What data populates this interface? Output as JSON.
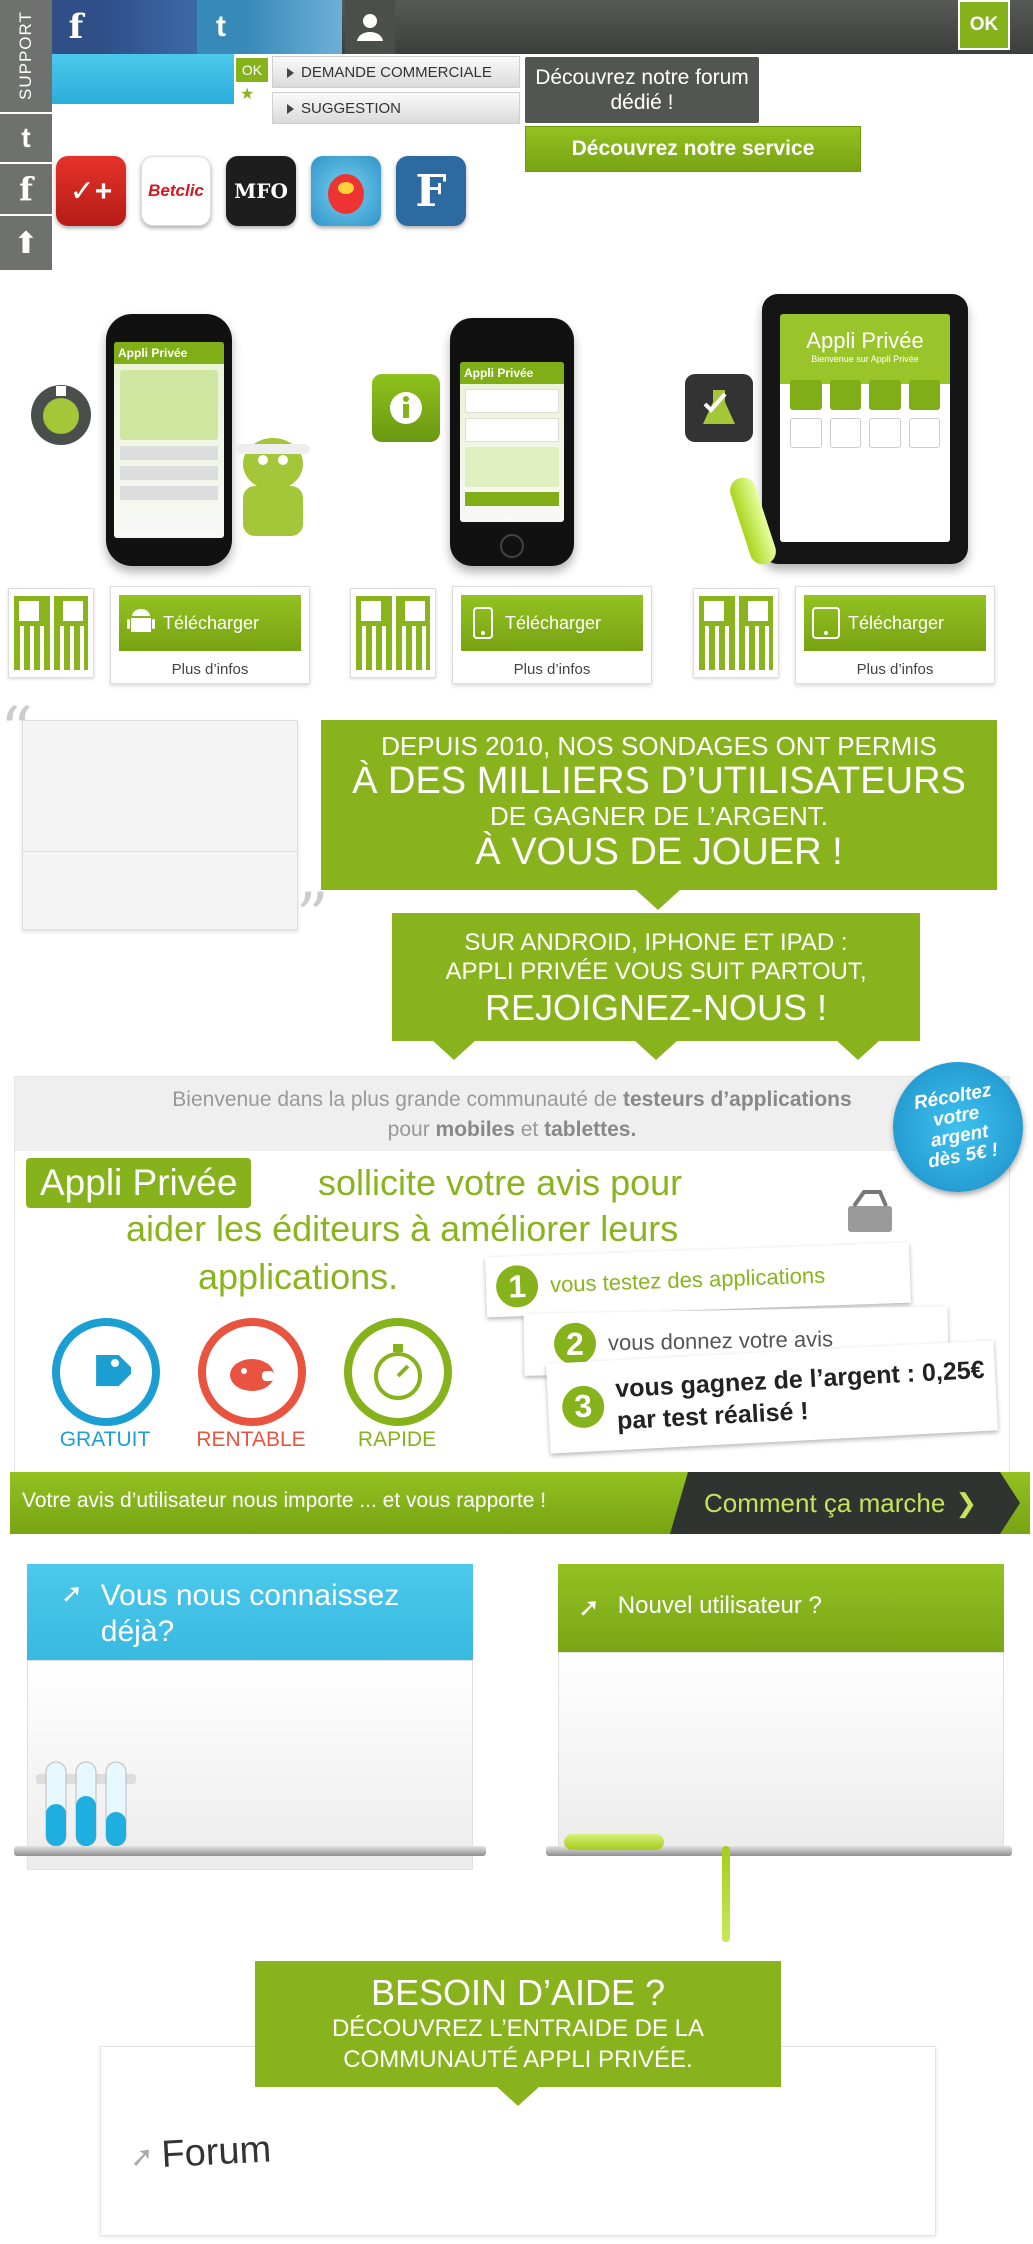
{
  "topbar": {
    "ok_label": "OK"
  },
  "side": {
    "support_label": "SUPPORT"
  },
  "contact": {
    "ok_label": "OK",
    "demande_label": "DEMANDE COMMERCIALE",
    "suggestion_label": "SUGGESTION",
    "forum_promo": "Découvrez notre forum dédié !",
    "service_label": "Découvrez notre service"
  },
  "partners": [
    {
      "name": "Nike+",
      "icon": "nike-plus-icon"
    },
    {
      "name": "Betclic",
      "icon": "betclic-icon"
    },
    {
      "name": "MFO",
      "icon": "mfo-energy-icon"
    },
    {
      "name": "Easter",
      "icon": "easter-game-icon"
    },
    {
      "name": "Figaro",
      "icon": "figaro-icon"
    }
  ],
  "devices": {
    "download_label": "Télécharger",
    "more_info_label": "Plus d’infos",
    "phone_screen_title": "Appli Privée",
    "ipad_welcome": "Bienvenue sur Appli Privée"
  },
  "banner": {
    "line1": "DEPUIS 2010, NOS SONDAGES ONT PERMIS",
    "line2": "À DES MILLIERS D’UTILISATEURS",
    "line3": "DE GAGNER DE L’ARGENT.",
    "line4": "À VOUS DE JOUER !"
  },
  "platforms": {
    "line1": "SUR ANDROID, IPHONE ET IPAD :",
    "line2": "APPLI PRIVÉE VOUS SUIT PARTOUT,",
    "line3": "REJOIGNEZ-NOUS !"
  },
  "welcome": {
    "intro_a": "Bienvenue dans la plus grande communauté de",
    "intro_b": "testeurs d’applications",
    "intro_c": "pour",
    "intro_d": "mobiles",
    "intro_e": "et",
    "intro_f": "tablettes.",
    "app_name": "Appli Privée",
    "slogan1": "sollicite votre avis pour",
    "slogan2": "aider les éditeurs à améliorer leurs",
    "slogan3": "applications.",
    "badge": "Récoltez votre argent dès 5€ !"
  },
  "features": [
    {
      "label": "GRATUIT",
      "color": "#1b9fd2",
      "icon": "tag-icon"
    },
    {
      "label": "RENTABLE",
      "color": "#e8543f",
      "icon": "piggy-bank-icon"
    },
    {
      "label": "RAPIDE",
      "color": "#86b21c",
      "icon": "stopwatch-icon"
    }
  ],
  "steps": [
    {
      "num": "1",
      "text": "vous testez des applications"
    },
    {
      "num": "2",
      "text": "vous donnez votre avis"
    },
    {
      "num": "3",
      "text": "vous gagnez de l’argent : 0,25€ par test réalisé !"
    }
  ],
  "ribbon": {
    "text": "Votre avis d’utilisateur nous importe ... et vous rapporte !",
    "cta": "Comment ça marche"
  },
  "login": {
    "existing_title": "Vous nous connaissez déjà?",
    "new_title": "Nouvel utilisateur ?"
  },
  "help": {
    "title": "BESOIN D’AIDE ?",
    "line1": "DÉCOUVREZ L’ENTRAIDE DE LA",
    "line2": "COMMUNAUTÉ APPLI PRIVÉE.",
    "forum_label": "Forum"
  },
  "colors": {
    "green": "#86b21c",
    "blue": "#2aaedb",
    "dark": "#2f3430"
  }
}
